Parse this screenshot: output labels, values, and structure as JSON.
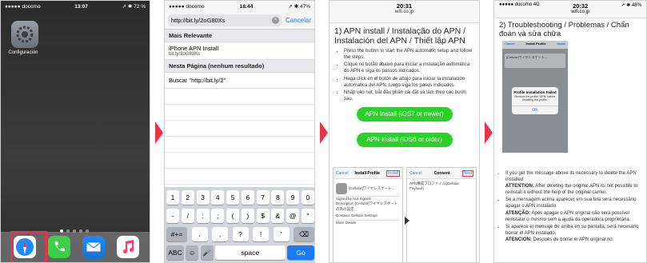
{
  "phone1": {
    "carrier": "●●●●● docomo",
    "time": "13:07",
    "battery": "72 %",
    "app_label": "Configuración"
  },
  "phone2": {
    "carrier": "●●●●● docomo",
    "time": "18:44",
    "battery": "47%",
    "url": "http://bit.ly/2oG80Xs",
    "cancel": "Cancelar",
    "section_top": "Mais Relevante",
    "suggestion_title": "iPhone APN Install",
    "suggestion_sub": "bit.ly/2oG80Xs",
    "section_page": "Nesta Página (nenhum resultado)",
    "search_suggestion": "Buscar \"http://bit.ly/2\"",
    "keyboard": {
      "row1": [
        "1",
        "2",
        "3",
        "4",
        "5",
        "6",
        "7",
        "8",
        "9",
        "0"
      ],
      "row2": [
        "-",
        "/",
        ":",
        ";",
        "(",
        ")",
        "$",
        "&",
        "@",
        "\""
      ],
      "row3": [
        "#+=",
        ".",
        ",",
        "?",
        "!",
        "'",
        "⌫"
      ],
      "row4": [
        "ABC",
        "☺",
        "🎤",
        "space",
        "Go"
      ]
    }
  },
  "phone3": {
    "time": "20:31",
    "domain": "wifi.co.jp",
    "title": "1) APN install / Instalação do APN / Instalación del APN / Thiết lập APN",
    "bullets": [
      "Press the button to start the APN automatic setup and follow the steps.",
      "Clique no botão abaixo para iniciar a instalação automática do APN e siga os passos indicados.",
      "Haga click en el botón de abajo para iniciar la instalación automatica del APN, luego siga los pasos indicados.",
      "Nhấp vào nút, bắt đầu phần cài đặt và làm theo các bước sau."
    ],
    "btn_ios7": "APN Install (iOS7 or newer)",
    "btn_ios6": "APN Install (iOS6 or older)",
    "mini1": {
      "cancel": "Cancel",
      "title": "Install Profile",
      "install": "Install",
      "profile_name": "[Cellular]ワイヤレスゲート...",
      "signed": "Signed by Not Signed",
      "description": "Description [Cellular]ワイヤレスゲートの為の設定",
      "contains": "Contains Cellular Settings",
      "more": "More Details"
    },
    "mini2": {
      "cancel": "Cancel",
      "title": "Consent",
      "next": "Next",
      "message": "APN構成プロファイル(Cellular Payload)"
    }
  },
  "phone4": {
    "carrier": "●●●●● docomo 4G",
    "time": "20:32",
    "domain": "wifi.co.jp",
    "battery": "48%",
    "title": "2) Troubleshooting / Problemas / Chẩn đoán và sửa chữa",
    "shot": {
      "cancel": "Cancel",
      "title": "Install Profile",
      "install": "Install",
      "profile_name": "[Cellular]ワイヤレスゲート...",
      "dialog_title": "Profile Installation Failed",
      "dialog_msg": "Remove the profile \"APN\" before installing this profile.",
      "dialog_ok": "OK"
    },
    "bullets": [
      {
        "text": "If you get the message above its necessary to delete the APN installed",
        "bold": "ATTENTION:",
        "rest": " After deleting the original APN its not possible to reinstall it without the help of the original carrier."
      },
      {
        "text": "Se a mensagem acima aparecer em sua tela será necessário apagar o APN instalado.",
        "bold": "ATENÇÃO:",
        "rest": " Após apagar o APN original não será possível reinstalar o mesmo sem a ajuda da operadora proprietária."
      },
      {
        "text": "Si aparece el mensaje de arriba en su pantalla, será necesario borrar el APN instalado.",
        "bold": "ATENCION:",
        "rest": " Después de borrar el APN original no"
      }
    ]
  },
  "colors": {
    "arrow": "#e8334a",
    "green_button": "#2ccf2c",
    "ios_blue": "#1a7cf3"
  }
}
